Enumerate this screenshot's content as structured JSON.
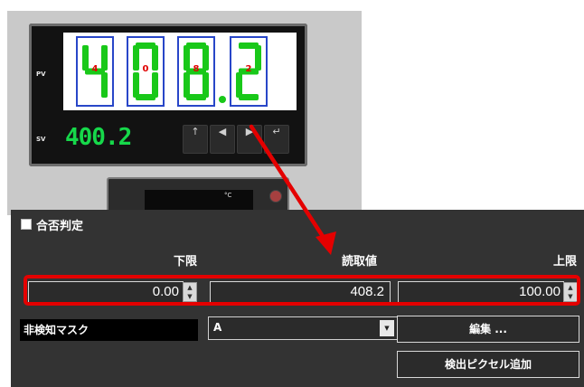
{
  "meter": {
    "pv_label": "PV",
    "sv_label": "SV",
    "pv_digits": [
      {
        "value": 4,
        "label": "4"
      },
      {
        "value": 0,
        "label": "0"
      },
      {
        "value": 8,
        "label": "8"
      },
      {
        "value": 2,
        "label": "2"
      }
    ],
    "sv_value": "400.2",
    "buttons": [
      {
        "icon": "up-arrow-icon",
        "glyph": "↑"
      },
      {
        "icon": "left-arrow-icon",
        "glyph": "◀"
      },
      {
        "icon": "right-arrow-icon",
        "glyph": "▶"
      },
      {
        "icon": "return-icon",
        "glyph": "↵"
      }
    ],
    "secondary_unit": "°C",
    "segment_color": "#19c819",
    "digit_border_color": "#2846c8",
    "digit_label_color": "#e00000"
  },
  "panel": {
    "section_title": "合否判定",
    "checked": false,
    "headers": {
      "lower": "下限",
      "reading": "読取値",
      "upper": "上限"
    },
    "lower_value": "0.00",
    "reading_value": "408.2",
    "upper_value": "100.00",
    "mask_label": "非検知マスク",
    "mask_option": "A",
    "edit_button": "編集 ...",
    "add_pixel_button": "検出ピクセル追加"
  },
  "highlight_color": "#e40000"
}
